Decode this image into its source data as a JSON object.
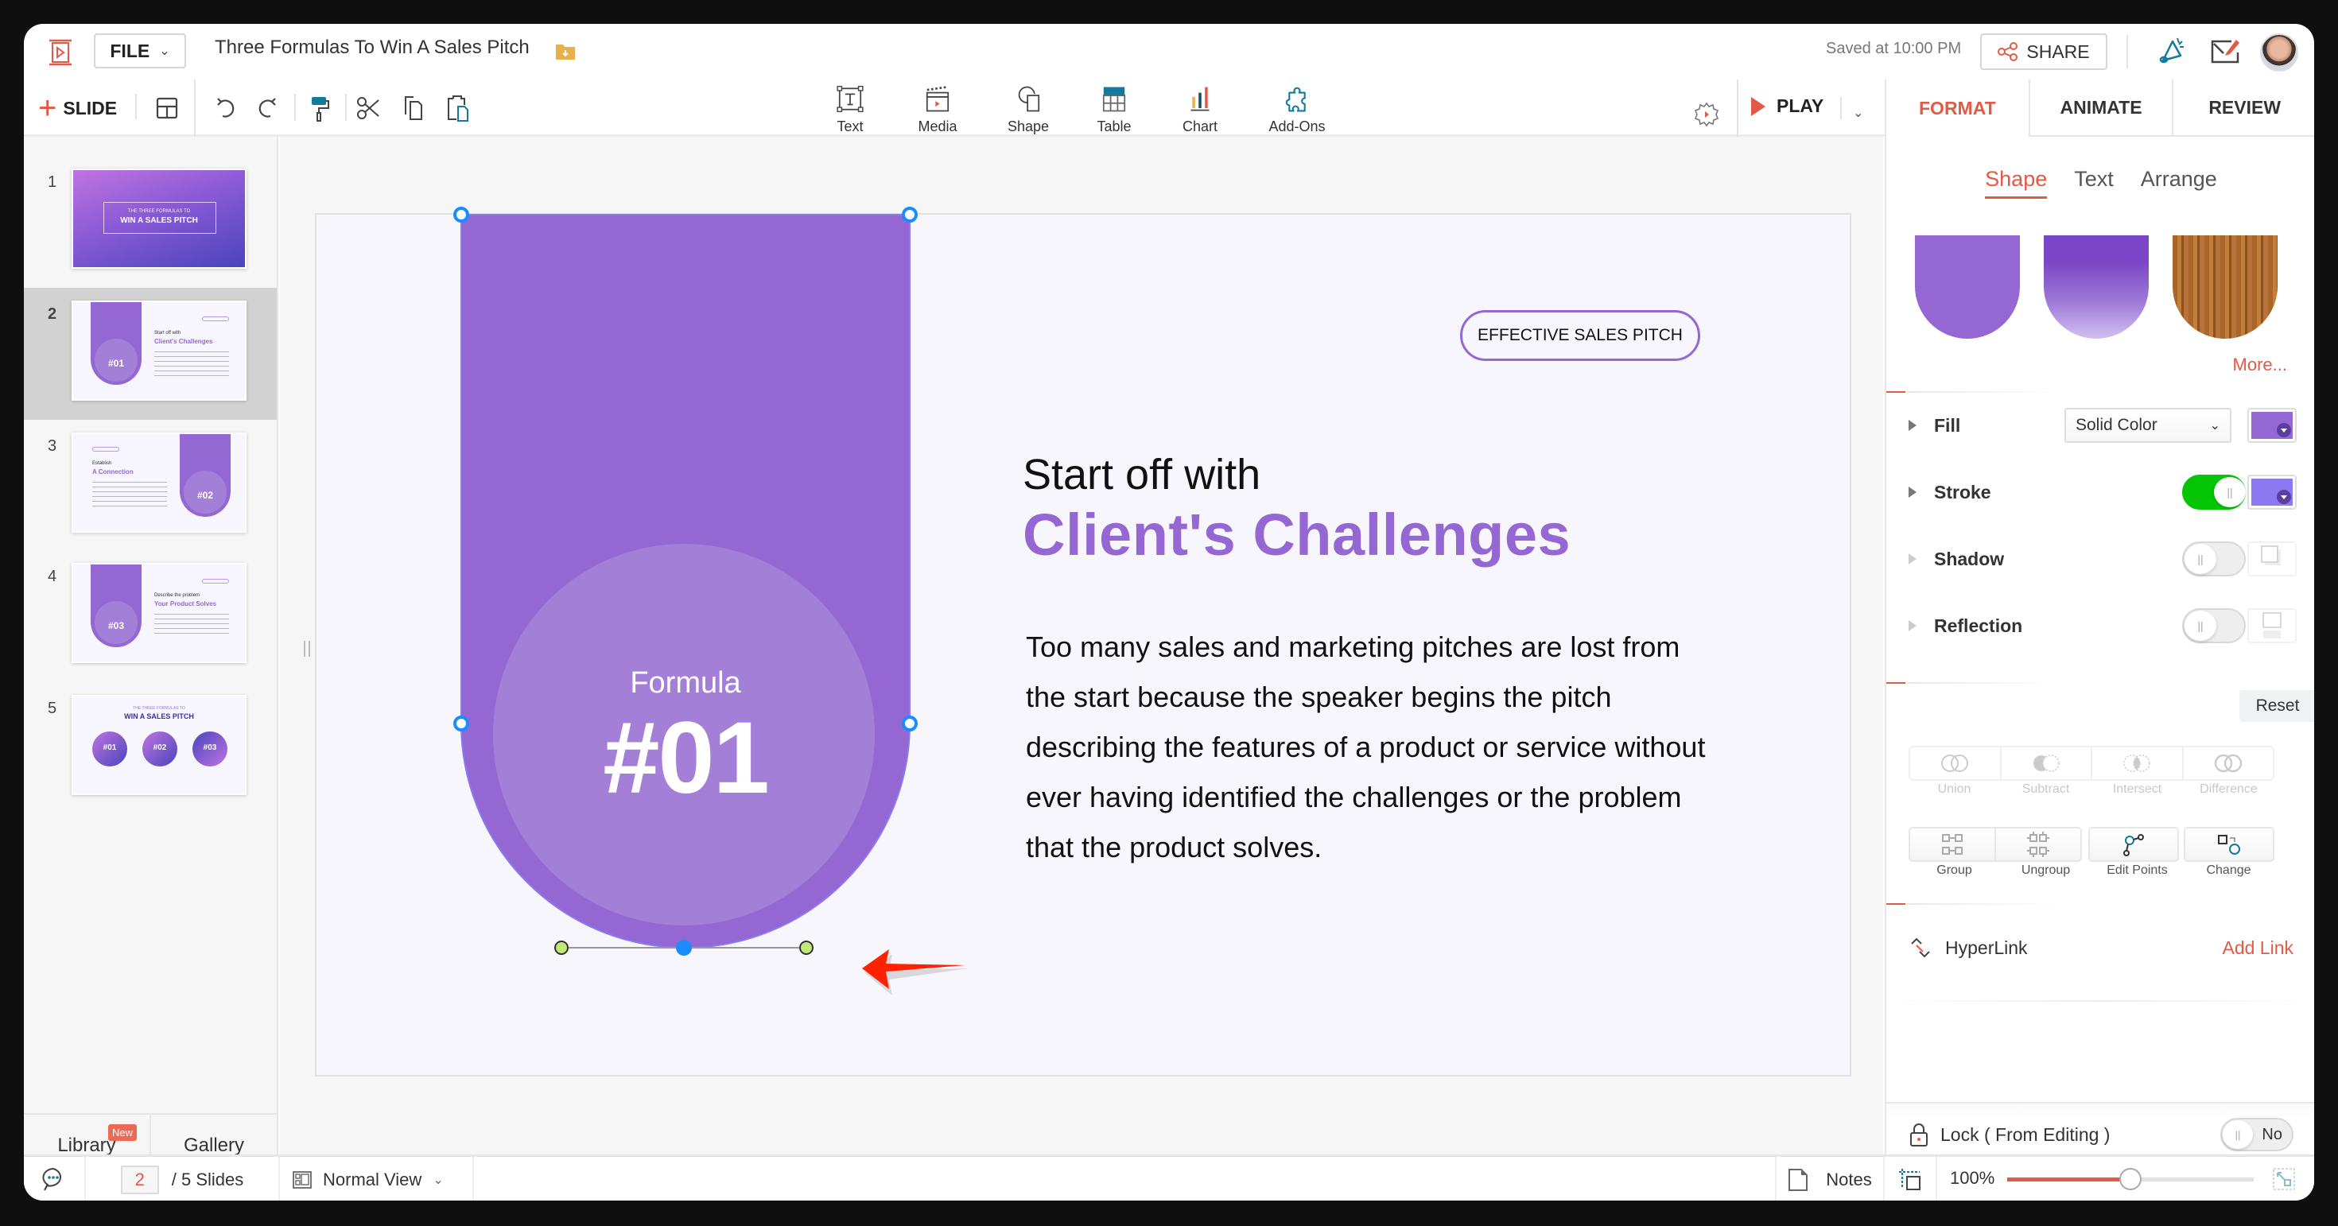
{
  "app": {
    "file_label": "FILE",
    "doc_title": "Three Formulas To Win A Sales Pitch",
    "saved_status": "Saved at 10:00 PM",
    "share_label": "SHARE"
  },
  "toolbar": {
    "slide_label": "SLIDE",
    "inserts": [
      {
        "label": "Text",
        "icon": "text-box-icon"
      },
      {
        "label": "Media",
        "icon": "clapperboard-icon"
      },
      {
        "label": "Shape",
        "icon": "shape-icon"
      },
      {
        "label": "Table",
        "icon": "table-icon"
      },
      {
        "label": "Chart",
        "icon": "bar-chart-icon"
      },
      {
        "label": "Add-Ons",
        "icon": "puzzle-icon"
      }
    ],
    "play_label": "PLAY"
  },
  "right_panel": {
    "tabs": [
      "FORMAT",
      "ANIMATE",
      "REVIEW"
    ],
    "active_tab": "FORMAT",
    "subtabs": [
      "Shape",
      "Text",
      "Arrange"
    ],
    "active_subtab": "Shape",
    "more_label": "More...",
    "fill": {
      "label": "Fill",
      "type": "Solid Color",
      "color": "#9467d3"
    },
    "stroke": {
      "label": "Stroke",
      "enabled": true,
      "color": "#8c78f0"
    },
    "shadow": {
      "label": "Shadow",
      "enabled": false
    },
    "reflection": {
      "label": "Reflection",
      "enabled": false
    },
    "reset_label": "Reset",
    "boolean_ops": [
      "Union",
      "Subtract",
      "Intersect",
      "Difference"
    ],
    "group_ops": [
      "Group",
      "Ungroup",
      "Edit Points",
      "Change"
    ],
    "hyperlink_label": "HyperLink",
    "add_link_label": "Add Link",
    "lock_label": "Lock ( From Editing )",
    "lock_value": "No"
  },
  "left_panel": {
    "slides": [
      {
        "num": "1",
        "title_small": "THE THREE FORMULAS TO",
        "title_big": "WIN A SALES PITCH"
      },
      {
        "num": "2",
        "subtitle": "Start off with",
        "title": "Client's Challenges",
        "badge": "#01"
      },
      {
        "num": "3",
        "subtitle": "Establish",
        "title": "A Connection",
        "badge": "#02"
      },
      {
        "num": "4",
        "subtitle": "Describe the problem",
        "title": "Your Product Solves",
        "badge": "#03"
      },
      {
        "num": "5",
        "title_small": "THE THREE FORMULAS TO",
        "title_big": "WIN A SALES PITCH",
        "badges": [
          "#01",
          "#02",
          "#03"
        ]
      }
    ],
    "active_slide": 2,
    "library_label": "Library",
    "new_badge": "New",
    "gallery_label": "Gallery"
  },
  "slide": {
    "pill_label": "EFFECTIVE SALES PITCH",
    "heading_line1": "Start off with",
    "heading_line2": "Client's Challenges",
    "body": "Too many sales and marketing pitches are lost from the start because the speaker begins the pitch describing the features of a product or service without ever having identified the challenges or the problem that the product solves.",
    "formula_label": "Formula",
    "formula_number": "#01",
    "accent_color": "#9467d3"
  },
  "status_bar": {
    "current_page": "2",
    "total_pages": "/ 5 Slides",
    "view_label": "Normal View",
    "notes_label": "Notes",
    "zoom_label": "100%",
    "zoom_fraction": 0.5
  }
}
